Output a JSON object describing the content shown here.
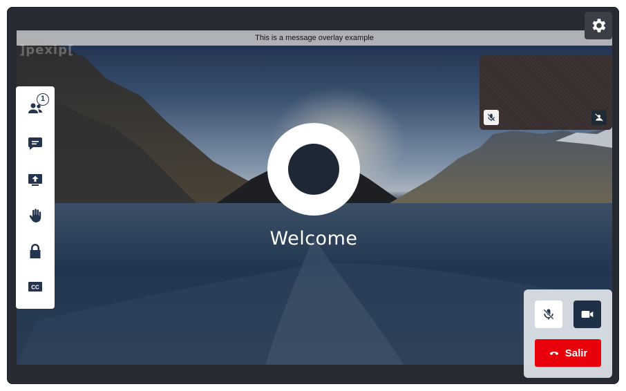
{
  "overlay": {
    "message": "This is a message overlay example"
  },
  "brand": {
    "watermark": "]pexip["
  },
  "main": {
    "welcome": "Welcome"
  },
  "sidebar": {
    "participants": {
      "icon": "participants-icon",
      "badge": "1"
    },
    "chat": {
      "icon": "chat-icon"
    },
    "share": {
      "icon": "share-screen-icon"
    },
    "raise_hand": {
      "icon": "raise-hand-icon"
    },
    "lock": {
      "icon": "lock-icon"
    },
    "captions": {
      "icon": "closed-captions-icon"
    }
  },
  "toolbar": {
    "settings_icon": "gear-icon"
  },
  "selfview": {
    "mic_icon": "mic-muted-icon",
    "camera_icon": "camera-off-icon"
  },
  "controls": {
    "mic_icon": "mic-muted-icon",
    "camera_icon": "video-camera-icon",
    "leave_label": "Salir",
    "leave_icon": "hang-up-icon"
  },
  "colors": {
    "accent_dark": "#23344e",
    "leave_red": "#e8000b"
  }
}
